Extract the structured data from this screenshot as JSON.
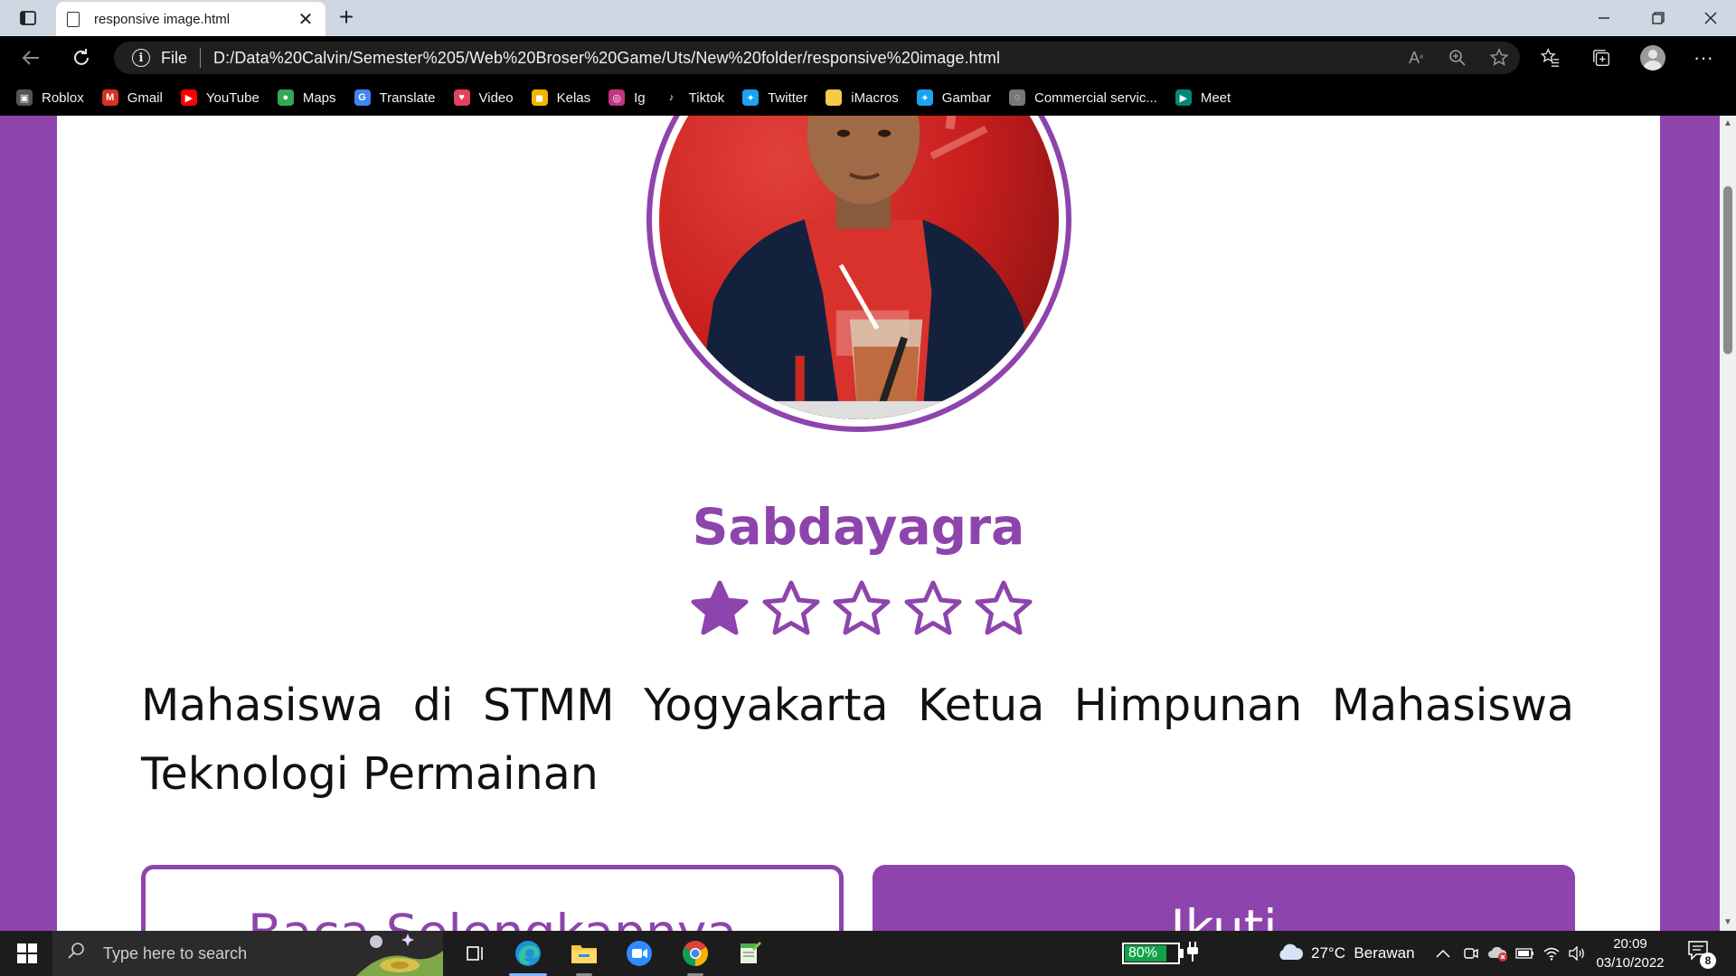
{
  "browser": {
    "tab": {
      "title": "responsive image.html"
    },
    "address": {
      "scheme_label": "File",
      "url": "D:/Data%20Calvin/Semester%205/Web%20Broser%20Game/Uts/New%20folder/responsive%20image.html"
    },
    "bookmarks": [
      {
        "label": "Roblox",
        "icon": "roblox-icon",
        "color": "#555555"
      },
      {
        "label": "Gmail",
        "icon": "gmail-icon",
        "color": "#d93025"
      },
      {
        "label": "YouTube",
        "icon": "youtube-icon",
        "color": "#ff0000"
      },
      {
        "label": "Maps",
        "icon": "maps-icon",
        "color": "#34a853"
      },
      {
        "label": "Translate",
        "icon": "translate-icon",
        "color": "#4285f4"
      },
      {
        "label": "Video",
        "icon": "video-icon",
        "color": "#e4405f"
      },
      {
        "label": "Kelas",
        "icon": "classroom-icon",
        "color": "#f4b400"
      },
      {
        "label": "Ig",
        "icon": "instagram-icon",
        "color": "#c13584"
      },
      {
        "label": "Tiktok",
        "icon": "tiktok-icon",
        "color": "#000000"
      },
      {
        "label": "Twitter",
        "icon": "twitter-icon",
        "color": "#1da1f2"
      },
      {
        "label": "iMacros",
        "icon": "folder-icon",
        "color": "#f7c948"
      },
      {
        "label": "Gambar",
        "icon": "twitter-icon",
        "color": "#1da1f2"
      },
      {
        "label": "Commercial servic...",
        "icon": "globe-icon",
        "color": "#777777"
      },
      {
        "label": "Meet",
        "icon": "meet-icon",
        "color": "#00897b"
      }
    ]
  },
  "profile": {
    "name": "Sabdayagra",
    "rating": {
      "value": 1,
      "max": 5
    },
    "bio": "Mahasiswa di STMM Yogyakarta Ketua Himpunan Mahasiswa Teknologi Permainan",
    "primary_button": "Baca Selengkapnya",
    "secondary_button": "Ikuti",
    "accent_color": "#8e44ad"
  },
  "taskbar": {
    "search_placeholder": "Type here to search",
    "battery": "80%",
    "battery_level": 0.8,
    "weather": "27°C  Berawan",
    "time": "20:09",
    "date": "03/10/2022",
    "notifications": "8"
  }
}
